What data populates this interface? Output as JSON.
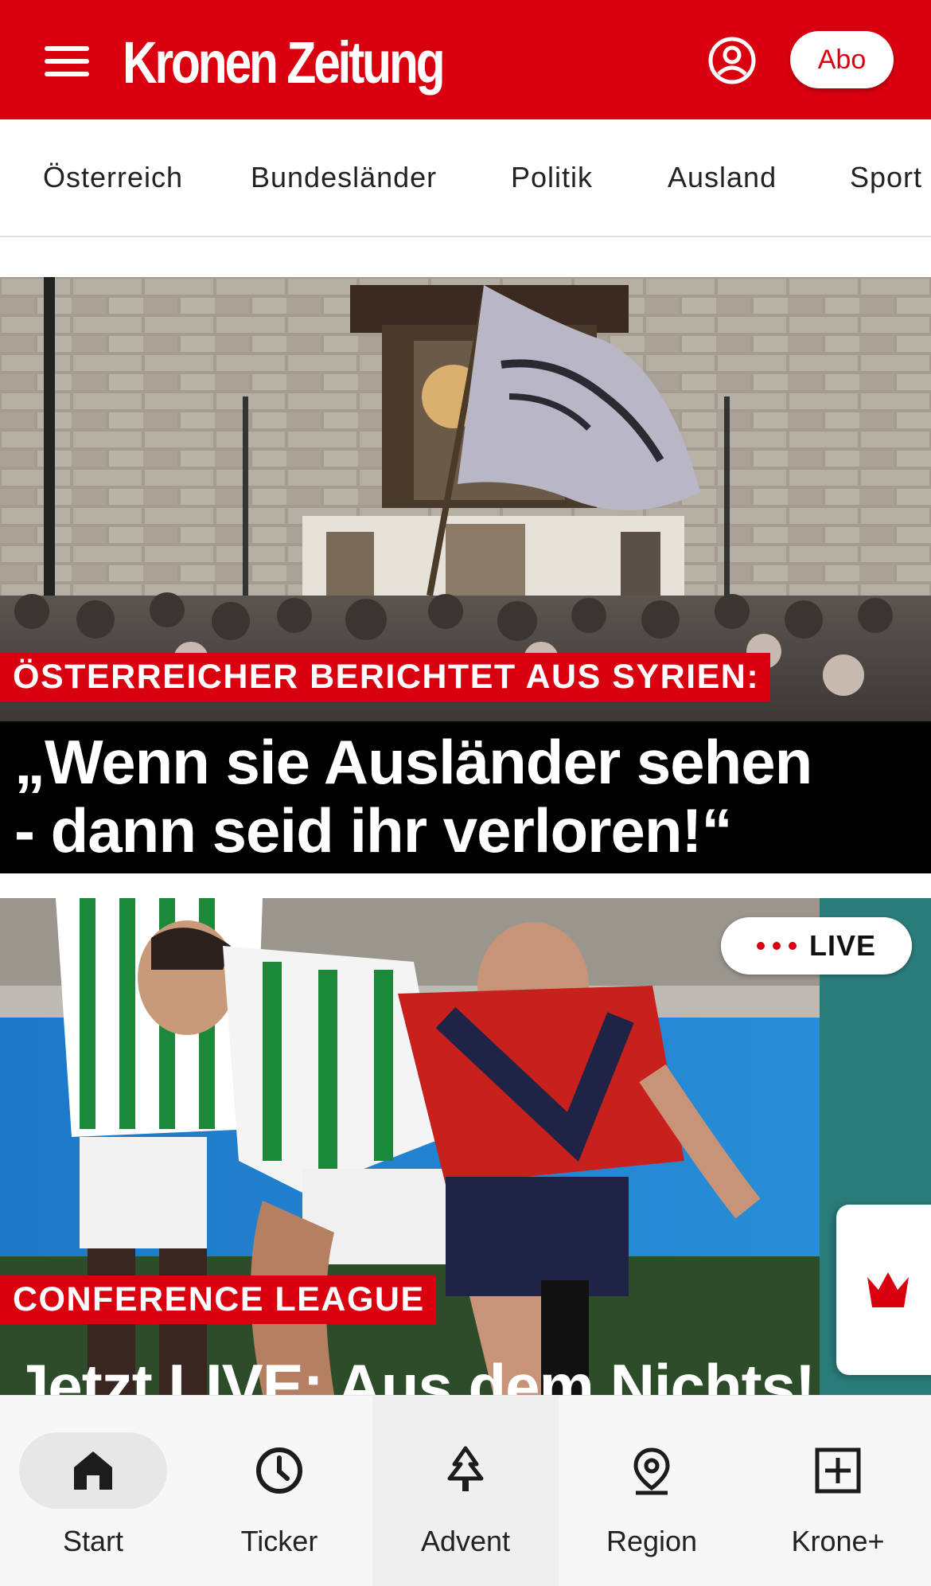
{
  "header": {
    "logo": "Kronen Zeitung",
    "subscribe_label": "Abo",
    "brand_color": "#d9000f",
    "menu_icon": "hamburger-menu-icon",
    "account_icon": "user-account-icon"
  },
  "nav": {
    "items": [
      "Österreich",
      "Bundesländer",
      "Politik",
      "Ausland",
      "Sport"
    ]
  },
  "articles": [
    {
      "kicker": "ÖSTERREICHER BERICHTET AUS SYRIEN:",
      "headline_line1": "„Wenn sie Ausländer sehen",
      "headline_line2": "- dann seid ihr verloren!“"
    },
    {
      "kicker": "CONFERENCE LEAGUE",
      "headline": "Jetzt LIVE: Aus dem Nichts!",
      "live_label": "LIVE"
    }
  ],
  "bottom_nav": {
    "items": [
      {
        "label": "Start",
        "icon": "home-icon"
      },
      {
        "label": "Ticker",
        "icon": "clock-icon"
      },
      {
        "label": "Advent",
        "icon": "tree-icon"
      },
      {
        "label": "Region",
        "icon": "location-pin-icon"
      },
      {
        "label": "Krone+",
        "icon": "plus-box-icon"
      }
    ]
  },
  "krone_plus_badge_icon": "crown-icon"
}
